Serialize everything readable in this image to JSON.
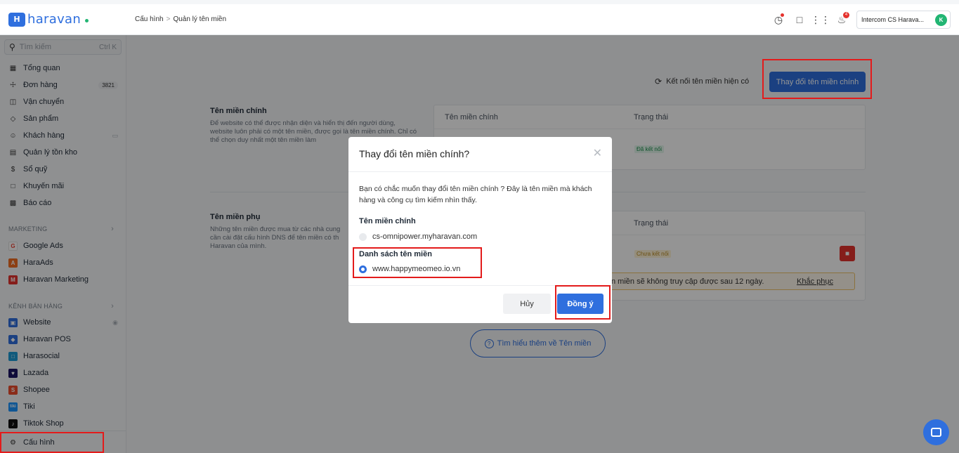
{
  "brand": {
    "name": "haravan",
    "logo_mark": "H"
  },
  "breadcrumb": {
    "parent": "Cấu hình",
    "separator": ">",
    "current": "Quản lý tên miền"
  },
  "topbar": {
    "account_name": "Intercom CS Harava...",
    "avatar_initial": "K",
    "notification_count": "4"
  },
  "search": {
    "placeholder": "Tìm kiếm",
    "shortcut": "Ctrl K"
  },
  "sidebar": {
    "items": [
      {
        "label": "Tổng quan",
        "icon": "grid-icon"
      },
      {
        "label": "Đơn hàng",
        "icon": "cart-icon",
        "count": "3821"
      },
      {
        "label": "Vận chuyển",
        "icon": "truck-icon"
      },
      {
        "label": "Sản phẩm",
        "icon": "tag-icon"
      },
      {
        "label": "Khách hàng",
        "icon": "users-icon"
      },
      {
        "label": "Quản lý tồn kho",
        "icon": "inventory-icon"
      },
      {
        "label": "Sổ quỹ",
        "icon": "cash-icon"
      },
      {
        "label": "Khuyến mãi",
        "icon": "gift-icon"
      },
      {
        "label": "Báo cáo",
        "icon": "report-icon"
      }
    ],
    "marketing_title": "MARKETING",
    "marketing_items": [
      {
        "label": "Google Ads",
        "icon": "google-icon",
        "color": "#ea4335"
      },
      {
        "label": "HaraAds",
        "icon": "haraads-icon",
        "color": "#f26d21"
      },
      {
        "label": "Haravan Marketing",
        "icon": "marketing-icon",
        "color": "#e5322d"
      }
    ],
    "sales_title": "KÊNH BÁN HÀNG",
    "sales_items": [
      {
        "label": "Website",
        "icon": "website-icon",
        "color": "#2f6fde"
      },
      {
        "label": "Haravan POS",
        "icon": "pos-icon",
        "color": "#2f6fde"
      },
      {
        "label": "Harasocial",
        "icon": "harasocial-icon",
        "color": "#1d9bd6"
      },
      {
        "label": "Lazada",
        "icon": "lazada-icon",
        "color": "#1a1464"
      },
      {
        "label": "Shopee",
        "icon": "shopee-icon",
        "color": "#ee4d2d"
      },
      {
        "label": "Tiki",
        "icon": "tiki-icon",
        "color": "#1a94ff"
      },
      {
        "label": "Tiktok Shop",
        "icon": "tiktok-icon",
        "color": "#111111"
      }
    ],
    "settings_label": "Cấu hình"
  },
  "actions": {
    "connect_label": "Kết nối tên miền hiện có",
    "change_primary_label": "Thay đổi tên miền chính"
  },
  "primary_section": {
    "title": "Tên miền chính",
    "description": "Để website có thể được nhận diện và hiển thị đến người dùng, website luôn phải có một tên miền, được gọi là tên miền chính. Chỉ có thể chọn duy nhất một tên miền làm",
    "col_domain": "Tên miền chính",
    "col_status": "Trạng thái",
    "status": "Đã kết nối"
  },
  "secondary_section": {
    "title": "Tên miền phụ",
    "description": "Những tên miền được mua từ các nhà cung cần cài đặt cấu hình DNS để tên miền có th Haravan của mình.",
    "col_status": "Trạng thái",
    "status": "Chưa kết nối",
    "warning": "n miền sẽ không truy cập được sau 12 ngày.",
    "fix_label": "Khắc phục"
  },
  "learn_more": "Tìm hiểu thêm về Tên miền",
  "modal": {
    "title": "Thay đổi tên miền chính?",
    "text": "Bạn có chắc muốn thay đổi tên miền chính ? Đây là tên miền mà khách hàng và công cụ tìm kiếm nhìn thấy.",
    "current_label": "Tên miền chính",
    "current_domain": "cs-omnipower.myharavan.com",
    "list_label": "Danh sách tên miền",
    "list_domain": "www.happymeomeo.io.vn",
    "cancel_label": "Hủy",
    "ok_label": "Đồng ý"
  }
}
